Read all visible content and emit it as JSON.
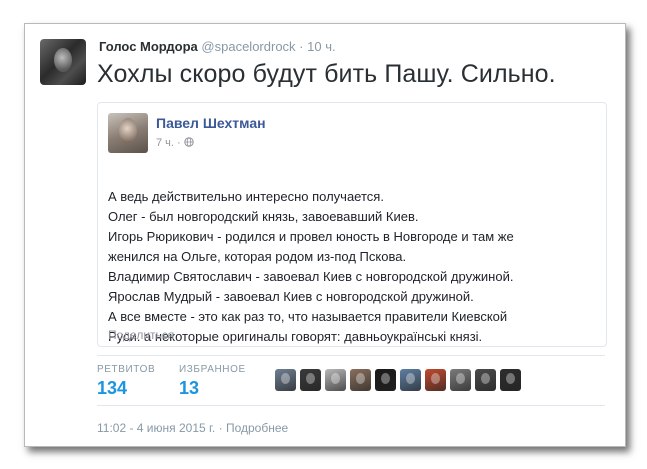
{
  "tweet": {
    "author_name": "Голос Мордора",
    "handle": "@spacelordrock",
    "separator": "·",
    "time": "10 ч.",
    "text": "Хохлы скоро будут бить Пашу. Сильно."
  },
  "quoted_post": {
    "author_name": "Павел Шехтман",
    "meta_time": "7 ч.",
    "meta_separator": "·",
    "meta_icon": "globe-icon",
    "lines": [
      "А ведь действительно интересно получается.",
      "Олег - был новгородский князь, завоевавший Киев.",
      "Игорь Рюрикович - родился и провел юность в Новгороде и там же",
      "женился на Ольге, которая родом из-под Пскова.",
      "Владимир Святославич - завоевал Киев с новгородской дружиной.",
      "Ярослав Мудрый - завоевал Киев с новгородской дружиной.",
      "А все вместе - это как раз то, что называется правители Киевской",
      "Руси. а некоторые оригиналы говорят: давньоукраїнські князі."
    ],
    "share_label": "Поделиться"
  },
  "stats": {
    "retweets_label": "РЕТВИТОВ",
    "retweets_value": "134",
    "favorites_label": "ИЗБРАННОЕ",
    "favorites_value": "13"
  },
  "favoriters": [
    {
      "icon": "city-skyline-avatar",
      "color": "#6f7f93"
    },
    {
      "icon": "person-avatar",
      "color": "#3a3a3a"
    },
    {
      "icon": "person-avatar",
      "color": "#b8b8b8"
    },
    {
      "icon": "person-avatar",
      "color": "#8a6f5d"
    },
    {
      "icon": "dark-logo-avatar",
      "color": "#1a1a1a"
    },
    {
      "icon": "person-avatar",
      "color": "#5e7fa3"
    },
    {
      "icon": "person-avatar",
      "color": "#c24a2e"
    },
    {
      "icon": "person-avatar",
      "color": "#7b7b7b"
    },
    {
      "icon": "person-avatar",
      "color": "#4b4b4b"
    },
    {
      "icon": "moon-avatar",
      "color": "#2d2d2d"
    }
  ],
  "footer": {
    "datetime": "11:02 - 4 июня 2015 г.",
    "separator": "·",
    "details_link": "Подробнее"
  }
}
